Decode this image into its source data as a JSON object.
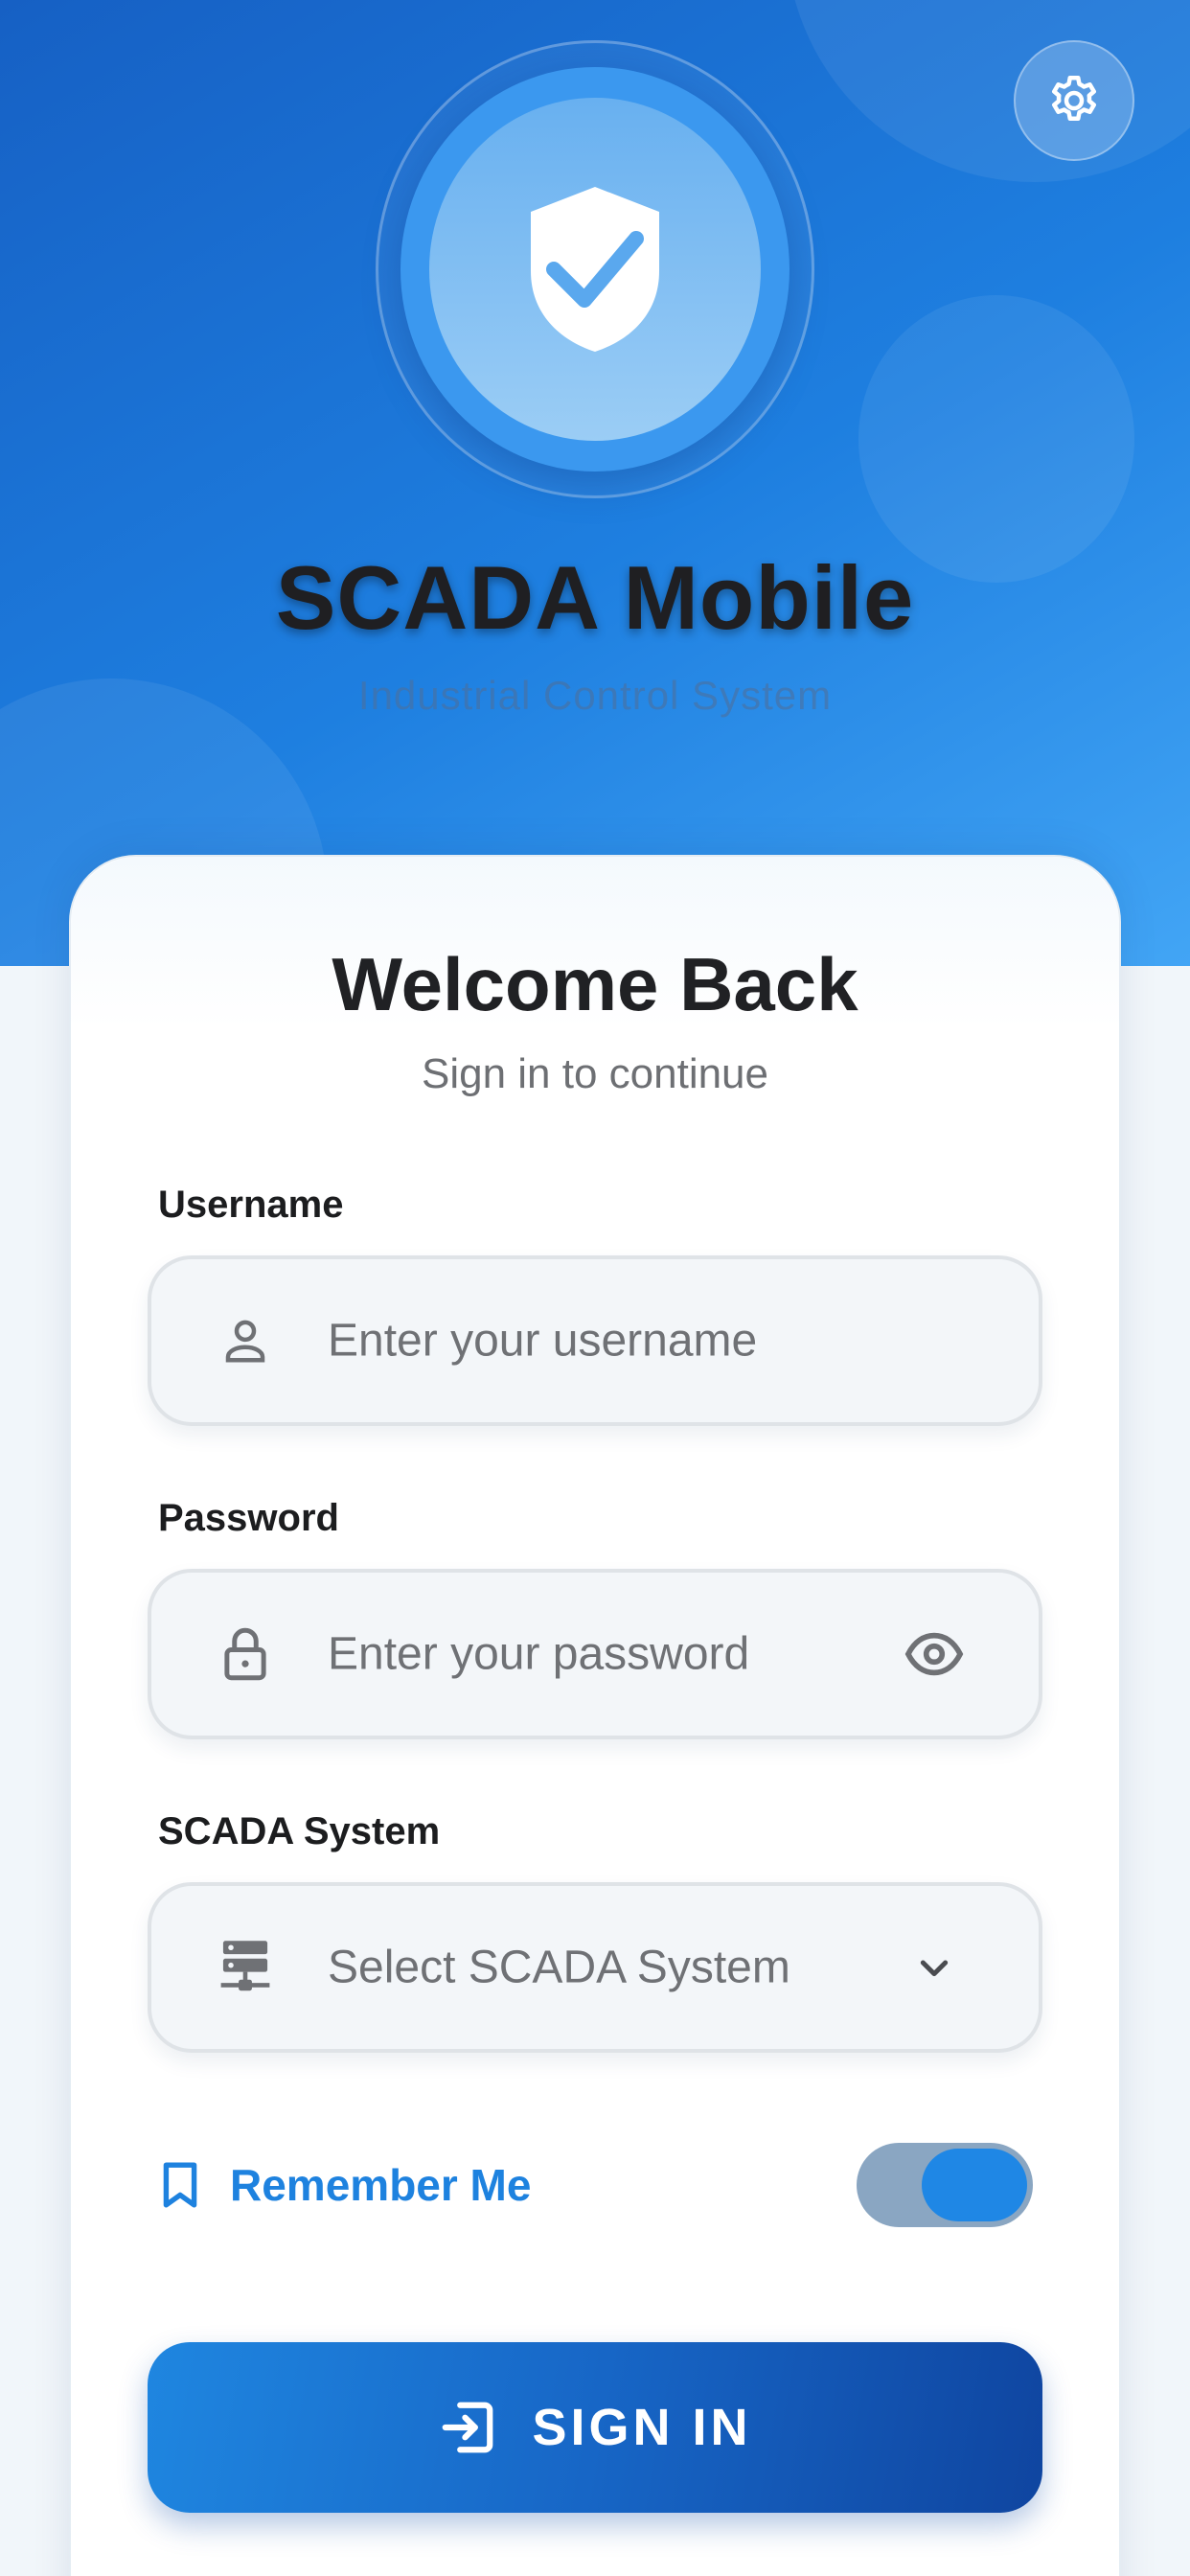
{
  "app": {
    "title": "SCADA Mobile",
    "subtitle": "Industrial Control System"
  },
  "header": {
    "settings_icon": "gear-icon",
    "logo_icon": "shield-check-icon"
  },
  "login": {
    "heading": "Welcome Back",
    "subheading": "Sign in to continue",
    "username": {
      "label": "Username",
      "placeholder": "Enter your username",
      "icon": "person-icon"
    },
    "password": {
      "label": "Password",
      "placeholder": "Enter your password",
      "icon": "lock-icon",
      "toggle_icon": "eye-icon"
    },
    "system": {
      "label": "SCADA System",
      "placeholder": "Select SCADA System",
      "icon": "server-icon",
      "dropdown_icon": "chevron-down-icon"
    },
    "remember_me": {
      "label": "Remember Me",
      "icon": "bookmark-icon",
      "enabled": true
    },
    "submit": {
      "label": "SIGN IN",
      "icon": "login-icon"
    }
  },
  "colors": {
    "brand_blue": "#1e82df",
    "hero_start": "#1660c4",
    "hero_end": "#42a5f5",
    "button_end": "#0f45a0"
  }
}
